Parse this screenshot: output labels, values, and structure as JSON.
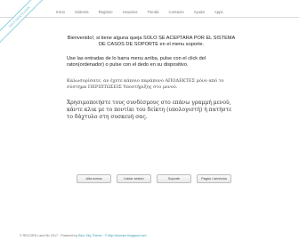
{
  "ribbon": {
    "text": "HELP NEW PLUGIN"
  },
  "nav": {
    "items": [
      "Inicio",
      "Sistema",
      "Registro",
      "Usuarios",
      "Tienda",
      "Contacto",
      "Ayuda",
      "Apps"
    ]
  },
  "content": {
    "intro": "Bienvenido!, si tiene alguna queja SOLO SE ACEPTARA POR EL SISTEMA DE CASOS DE SOPORTE en el menu soporte.",
    "instructions": "Use las entradas de lo barra menu arriba, pulse con el click del raton(ordenador) o pulse con el dedo en su dispositivo.",
    "greek1": "Καλωσορίσατε, αν έχετε κάποιο παράπονο ΑΠΟΔΕΚΤΕΣ μόνο από το σύστημα ΠΕΡΙΠΤΩΣΕΙΣ Υποστήριξης στο μενού.",
    "greek2": "Χρησιμοποιήστε τους συνδέσμους στο επάνω γραμμή μενού, κάντε κλικ με το ποντίκι του δείκτη (υπολογιστή) ή πατήστε το δάχτυλο στη συσκευή σας."
  },
  "buttons": [
    "Alta nueva",
    "Iniciar sesión",
    "Soporte",
    "Pagos / servicios"
  ],
  "footer": {
    "left": "© RECORD Land Mc 2017 · Powered by",
    "link": "Blue Sky Theme - © http://domain.blogspot.com"
  }
}
